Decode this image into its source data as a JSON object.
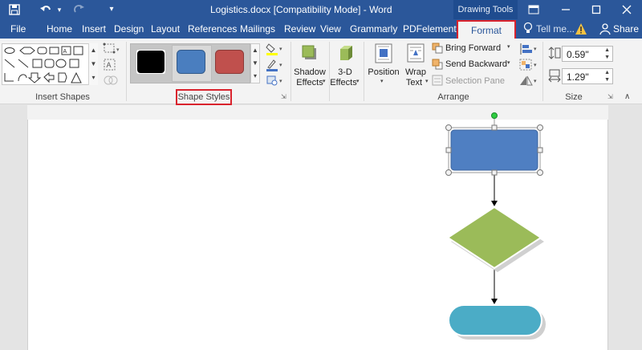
{
  "window": {
    "title": "Logistics.docx [Compatibility Mode] - Word",
    "context_tab_group": "Drawing Tools"
  },
  "tabs": [
    "File",
    "Home",
    "Insert",
    "Design",
    "Layout",
    "References",
    "Mailings",
    "Review",
    "View",
    "Grammarly",
    "PDFelement",
    "Format"
  ],
  "tell_me": "Tell me...",
  "share": "Share",
  "ribbon": {
    "groups": {
      "insert_shapes": "Insert Shapes",
      "shape_styles": "Shape Styles",
      "arrange": "Arrange",
      "size": "Size"
    },
    "shadow_effects": [
      "Shadow",
      "Effects"
    ],
    "three_d_effects": [
      "3-D",
      "Effects"
    ],
    "position": "Position",
    "wrap_text": [
      "Wrap",
      "Text"
    ],
    "bring_forward": "Bring Forward",
    "send_backward": "Send Backward",
    "selection_pane": "Selection Pane",
    "height_value": "0.59\"",
    "width_value": "1.29\""
  },
  "colors": {
    "brand": "#2b579a",
    "highlight": "#d9232d",
    "swatch_black": "#000000",
    "swatch_blue": "#4a7ebf",
    "swatch_red": "#c0504d",
    "flow_rect": "#4f7fc2",
    "flow_diamond": "#9bbb59",
    "flow_terminal": "#4bacc6"
  }
}
